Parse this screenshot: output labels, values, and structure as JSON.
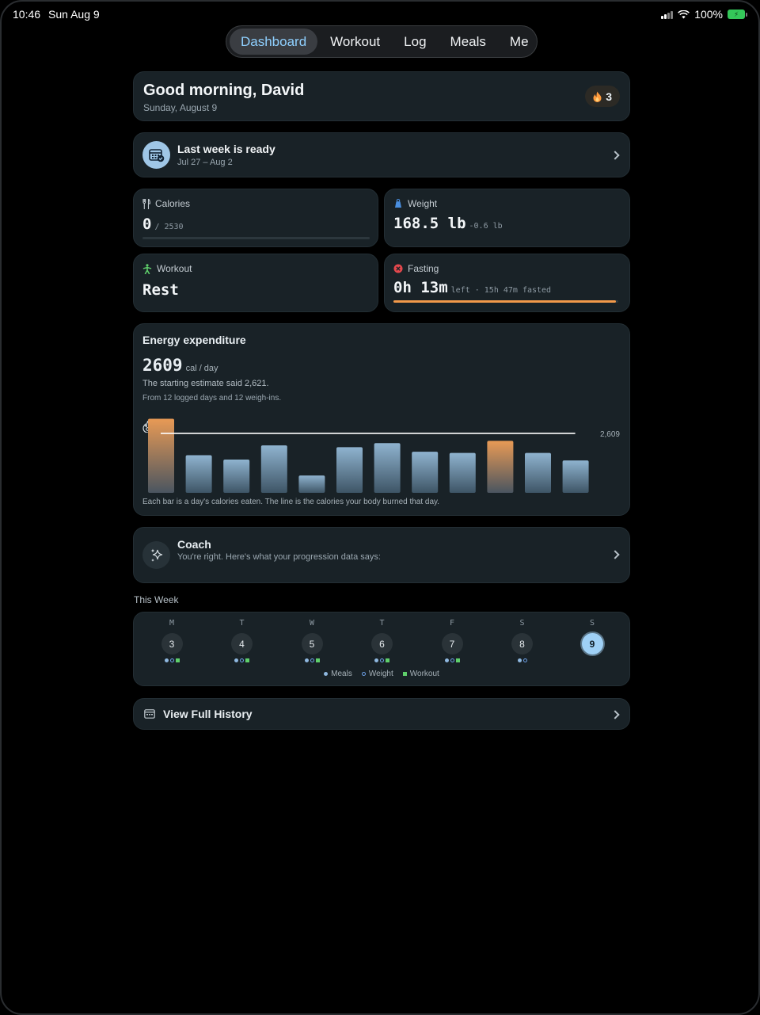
{
  "status_bar": {
    "time": "10:46",
    "date": "Sun Aug 9",
    "battery": "100%"
  },
  "nav": {
    "tabs": [
      "Dashboard",
      "Workout",
      "Log",
      "Meals",
      "Me"
    ],
    "active": "Dashboard"
  },
  "greeting": {
    "title": "Good morning, David",
    "date": "Sunday, August 9",
    "streak": "3"
  },
  "weekly_report": {
    "title": "Last week is ready",
    "range": "Jul 27 – Aug 2"
  },
  "stats": {
    "calories": {
      "label": "Calories",
      "value": "0",
      "goal": "/ 2530",
      "progress": 0
    },
    "weight": {
      "label": "Weight",
      "value": "168.5 lb",
      "change": "-0.6 lb"
    },
    "workout": {
      "label": "Workout",
      "value": "Rest"
    },
    "fasting": {
      "label": "Fasting",
      "value": "0h 13m",
      "detail": "left · 15h 47m fasted",
      "progress": 0.99
    }
  },
  "energy": {
    "title": "Energy expenditure",
    "value": "2609",
    "unit": "cal / day",
    "line1": "The starting estimate said 2,621.",
    "line2": "From 12 logged days and 12 weigh-ins.",
    "caption": "Each bar is a day's calories eaten. The line is the calories your body burned that day."
  },
  "chart_data": {
    "type": "bar",
    "values": [
      3250,
      1650,
      1460,
      2080,
      760,
      2000,
      2180,
      1800,
      1750,
      2280,
      1750,
      1420
    ],
    "highlighted": [
      0,
      9
    ],
    "line_value": 2609,
    "line_label": "2,609",
    "ylim": [
      0,
      3300
    ],
    "colors": {
      "bar": "#8fb3cf",
      "highlight": "#e89a55",
      "line": "#ffffff"
    }
  },
  "coach": {
    "title": "Coach",
    "message": "You're right. Here's what your progression data says:"
  },
  "this_week": {
    "label": "This Week",
    "days": [
      {
        "letter": "M",
        "num": "3",
        "meal": true,
        "weight": true,
        "workout": true,
        "today": false
      },
      {
        "letter": "T",
        "num": "4",
        "meal": true,
        "weight": true,
        "workout": true,
        "today": false
      },
      {
        "letter": "W",
        "num": "5",
        "meal": true,
        "weight": true,
        "workout": true,
        "today": false
      },
      {
        "letter": "T",
        "num": "6",
        "meal": true,
        "weight": true,
        "workout": true,
        "today": false
      },
      {
        "letter": "F",
        "num": "7",
        "meal": true,
        "weight": true,
        "workout": true,
        "today": false
      },
      {
        "letter": "S",
        "num": "8",
        "meal": true,
        "weight": true,
        "workout": false,
        "today": false
      },
      {
        "letter": "S",
        "num": "9",
        "meal": false,
        "weight": false,
        "workout": false,
        "today": true
      }
    ],
    "legend": {
      "meals": "Meals",
      "weight": "Weight",
      "workout": "Workout"
    }
  },
  "history": {
    "label": "View Full History"
  }
}
